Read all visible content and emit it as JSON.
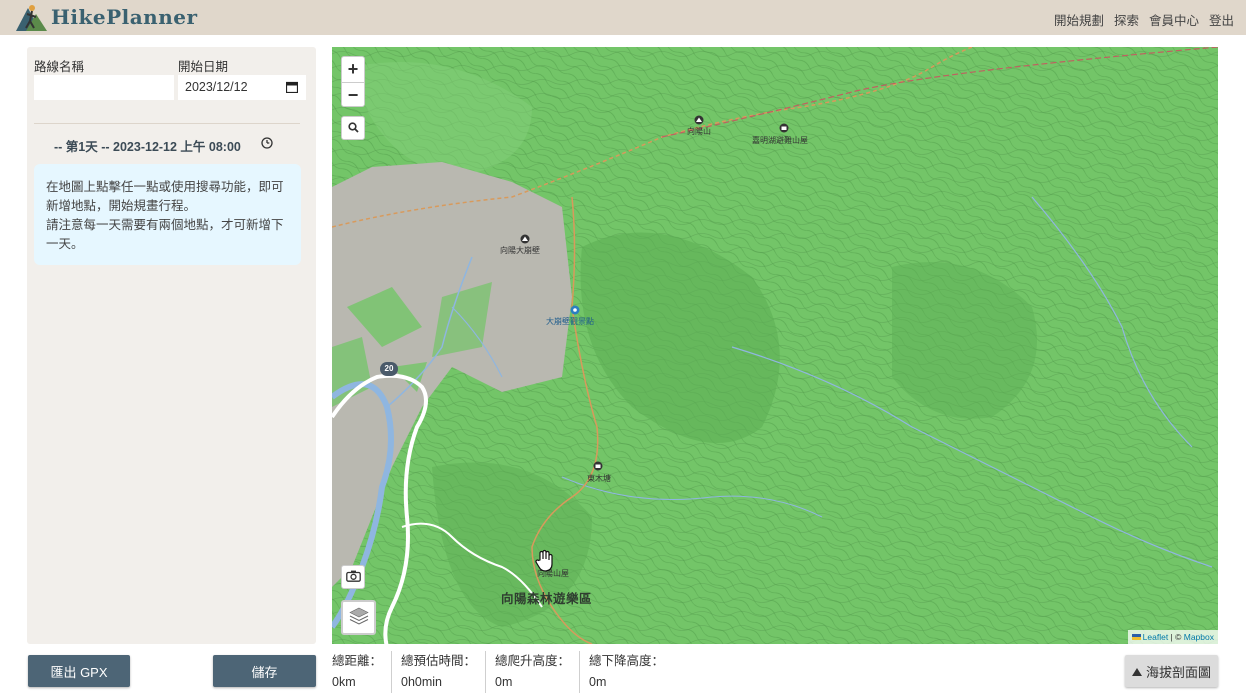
{
  "app": {
    "title": "HikePlanner"
  },
  "nav": {
    "items": [
      "開始規劃",
      "探索",
      "會員中心",
      "登出"
    ]
  },
  "form": {
    "route_name_label": "路線名稱",
    "route_name_value": "",
    "start_date_label": "開始日期",
    "start_date_value": "2023/12/12"
  },
  "day": {
    "title": "-- 第1天 -- 2023-12-12 上午 08:00"
  },
  "hint": {
    "line1": "在地圖上點擊任一點或使用搜尋功能，即可新增地點，開始規畫行程。",
    "line2": "請注意每一天需要有兩個地點，才可新增下一天。"
  },
  "buttons": {
    "export_gpx": "匯出 GPX",
    "save": "儲存",
    "elevation": "海拔剖面圖"
  },
  "map": {
    "zoom_in": "+",
    "zoom_out": "−",
    "pois": [
      "向陽山",
      "嘉明湖避難山屋",
      "向陽大崩壁",
      "大崩壁觀景點",
      "東木塘",
      "向陽山屋"
    ],
    "area_label": "向陽森林遊樂區",
    "road_shield": "20",
    "attribution": {
      "leaflet": "Leaflet",
      "sep": " | © ",
      "mapbox": "Mapbox"
    },
    "colors": {
      "forest": "#73c568",
      "rock": "#b9b8b0",
      "river": "#8fb6e0",
      "trail": "#d89a5c",
      "road": "#ffffff"
    }
  },
  "stats": {
    "distance_label": "總距離：",
    "distance_value": "0km",
    "time_label": "總預估時間：",
    "time_value": "0h0min",
    "ascent_label": "總爬升高度：",
    "ascent_value": "0m",
    "descent_label": "總下降高度：",
    "descent_value": "0m"
  }
}
